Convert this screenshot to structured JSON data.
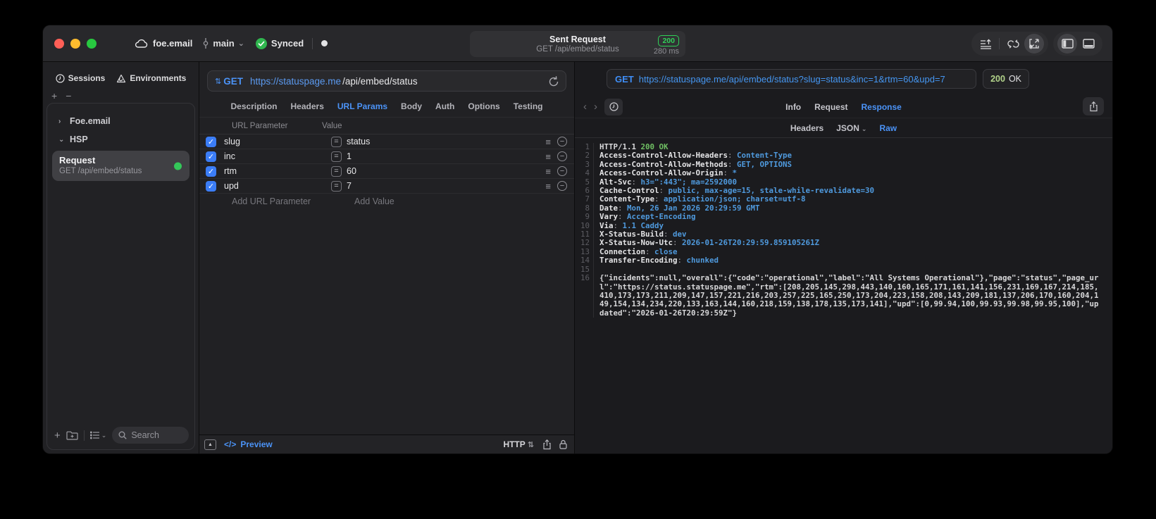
{
  "icons": {
    "plus": "+",
    "minus": "−",
    "chevron_right": "›",
    "chevron_down": "⌄",
    "updown": "⇅",
    "back": "‹",
    "forward": "›",
    "eq": "=",
    "hamburger": "☰",
    "row_minus": "−",
    "code": "</>",
    "triangle_up": "▲",
    "dot": "●",
    "check": "✓"
  },
  "titlebar": {
    "project": "foe.email",
    "branch": "main",
    "sync_status": "Synced",
    "center": {
      "title": "Sent Request",
      "subtitle": "GET /api/embed/status",
      "status_code": "200",
      "duration": "280 ms"
    }
  },
  "sidebar": {
    "tabs": [
      {
        "label": "Sessions"
      },
      {
        "label": "Environments"
      }
    ],
    "tree": [
      {
        "label": "Foe.email",
        "expanded": false
      },
      {
        "label": "HSP",
        "expanded": true
      }
    ],
    "selected_request": {
      "name": "Request",
      "subtitle": "GET /api/embed/status"
    },
    "search_placeholder": "Search"
  },
  "request_editor": {
    "method": "GET",
    "url_host": "https://statuspage.me",
    "url_path": "/api/embed/status",
    "tabs": [
      "Description",
      "Headers",
      "URL Params",
      "Body",
      "Auth",
      "Options",
      "Testing"
    ],
    "active_tab": "URL Params",
    "params_table": {
      "columns": [
        "URL Parameter",
        "Value"
      ],
      "rows": [
        {
          "enabled": true,
          "name": "slug",
          "value": "status"
        },
        {
          "enabled": true,
          "name": "inc",
          "value": "1"
        },
        {
          "enabled": true,
          "name": "rtm",
          "value": "60"
        },
        {
          "enabled": true,
          "name": "upd",
          "value": "7"
        }
      ],
      "add_name_placeholder": "Add URL Parameter",
      "add_value_placeholder": "Add Value"
    },
    "footer": {
      "preview_label": "Preview",
      "protocol": "HTTP"
    }
  },
  "response_panel": {
    "method": "GET",
    "url": "https://statuspage.me/api/embed/status?slug=status&inc=1&rtm=60&upd=7",
    "status": {
      "code": "200",
      "text": "OK"
    },
    "tabs": [
      "Info",
      "Request",
      "Response"
    ],
    "active_tab": "Response",
    "subtabs": [
      {
        "label": "Headers",
        "dropdown": false
      },
      {
        "label": "JSON",
        "dropdown": true
      },
      {
        "label": "Raw",
        "dropdown": false
      }
    ],
    "active_subtab": "Raw",
    "body_lines": [
      {
        "n": "1",
        "parts": [
          {
            "t": "HTTP/1.1 ",
            "c": "plain"
          },
          {
            "t": "200 OK",
            "c": "green"
          }
        ]
      },
      {
        "n": "2",
        "parts": [
          {
            "t": "Access-Control-Allow-Headers",
            "c": "key"
          },
          {
            "t": ": ",
            "c": "dim"
          },
          {
            "t": "Content-Type",
            "c": "val"
          }
        ]
      },
      {
        "n": "3",
        "parts": [
          {
            "t": "Access-Control-Allow-Methods",
            "c": "key"
          },
          {
            "t": ": ",
            "c": "dim"
          },
          {
            "t": "GET, OPTIONS",
            "c": "val"
          }
        ]
      },
      {
        "n": "4",
        "parts": [
          {
            "t": "Access-Control-Allow-Origin",
            "c": "key"
          },
          {
            "t": ": ",
            "c": "dim"
          },
          {
            "t": "*",
            "c": "val"
          }
        ]
      },
      {
        "n": "5",
        "parts": [
          {
            "t": "Alt-Svc",
            "c": "key"
          },
          {
            "t": ": ",
            "c": "dim"
          },
          {
            "t": "h3=\":443\"; ma=2592000",
            "c": "val"
          }
        ]
      },
      {
        "n": "6",
        "parts": [
          {
            "t": "Cache-Control",
            "c": "key"
          },
          {
            "t": ": ",
            "c": "dim"
          },
          {
            "t": "public, max-age=15, stale-while-revalidate=30",
            "c": "val"
          }
        ]
      },
      {
        "n": "7",
        "parts": [
          {
            "t": "Content-Type",
            "c": "key"
          },
          {
            "t": ": ",
            "c": "dim"
          },
          {
            "t": "application/json; charset=utf-8",
            "c": "val"
          }
        ]
      },
      {
        "n": "8",
        "parts": [
          {
            "t": "Date",
            "c": "key"
          },
          {
            "t": ": ",
            "c": "dim"
          },
          {
            "t": "Mon, 26 Jan 2026 20:29:59 GMT",
            "c": "val"
          }
        ]
      },
      {
        "n": "9",
        "parts": [
          {
            "t": "Vary",
            "c": "key"
          },
          {
            "t": ": ",
            "c": "dim"
          },
          {
            "t": "Accept-Encoding",
            "c": "val"
          }
        ]
      },
      {
        "n": "10",
        "parts": [
          {
            "t": "Via",
            "c": "key"
          },
          {
            "t": ": ",
            "c": "dim"
          },
          {
            "t": "1.1 Caddy",
            "c": "val"
          }
        ]
      },
      {
        "n": "11",
        "parts": [
          {
            "t": "X-Status-Build",
            "c": "key"
          },
          {
            "t": ": ",
            "c": "dim"
          },
          {
            "t": "dev",
            "c": "val"
          }
        ]
      },
      {
        "n": "12",
        "parts": [
          {
            "t": "X-Status-Now-Utc",
            "c": "key"
          },
          {
            "t": ": ",
            "c": "dim"
          },
          {
            "t": "2026-01-26T20:29:59.859105261Z",
            "c": "val"
          }
        ]
      },
      {
        "n": "13",
        "parts": [
          {
            "t": "Connection",
            "c": "key"
          },
          {
            "t": ": ",
            "c": "dim"
          },
          {
            "t": "close",
            "c": "val"
          }
        ]
      },
      {
        "n": "14",
        "parts": [
          {
            "t": "Transfer-Encoding",
            "c": "key"
          },
          {
            "t": ": ",
            "c": "dim"
          },
          {
            "t": "chunked",
            "c": "val"
          }
        ]
      },
      {
        "n": "15",
        "parts": []
      },
      {
        "n": "16",
        "parts": [
          {
            "t": "{\"incidents\":null,\"overall\":{\"code\":\"operational\",\"label\":\"All Systems Operational\"},\"page\":\"status\",\"page_url\":\"https://status.statuspage.me\",\"rtm\":[208,205,145,298,443,140,160,165,171,161,141,156,231,169,167,214,185,410,173,173,211,209,147,157,221,216,203,257,225,165,250,173,204,223,158,208,143,209,181,137,206,170,160,204,149,154,134,234,220,133,163,144,160,218,159,138,178,135,173,141],\"upd\":[0,99.94,100,99.93,99.98,99.95,100],\"updated\":\"2026-01-26T20:29:59Z\"}",
            "c": "plain"
          }
        ]
      }
    ]
  }
}
